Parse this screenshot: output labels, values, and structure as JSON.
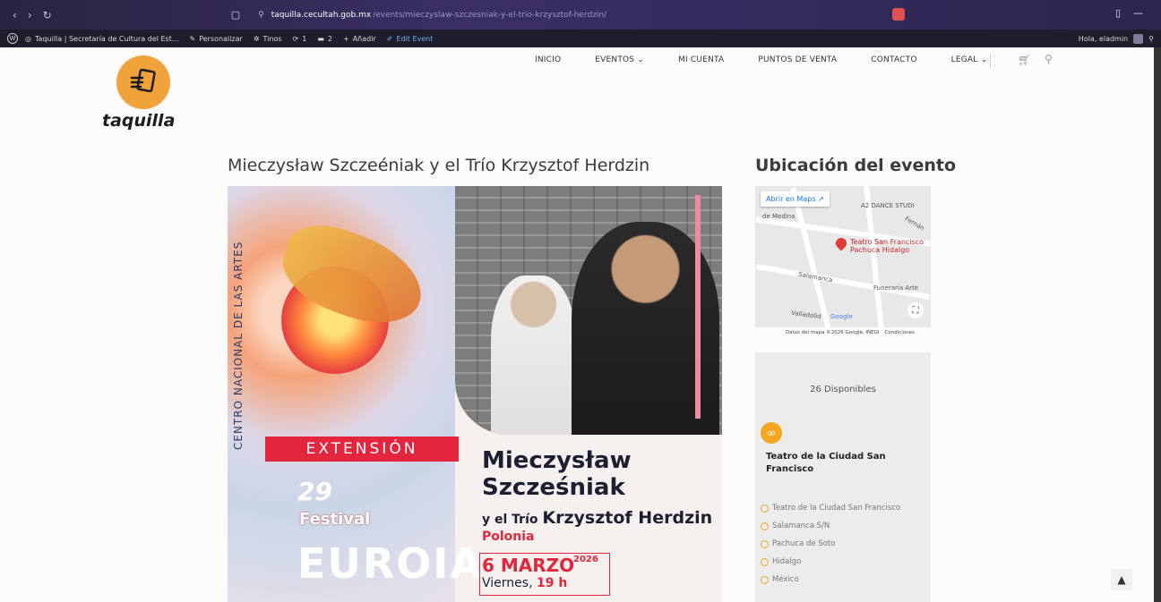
{
  "browser": {
    "url_host": "taquilla.cecultah.gob.mx",
    "url_path": "/events/mieczyslaw-szczesniak-y-el-trio-krzysztof-herdzin/"
  },
  "wp_bar": {
    "site": "Taquilla | Secretaría de Cultura del Est...",
    "customize": "Personalizar",
    "themes": "Tinos",
    "updates": "1",
    "comments": "2",
    "add": "Añadir",
    "edit": "Edit Event",
    "greeting": "Hola, eladmin"
  },
  "site": {
    "logo_text": "taquilla"
  },
  "nav": {
    "items": [
      "INICIO",
      "EVENTOS ⌄",
      "MI CUENTA",
      "PUNTOS DE VENTA",
      "CONTACTO",
      "LEGAL ⌄"
    ]
  },
  "event": {
    "title": "Mieczysław Szczeéniak y el Trío Krzysztof Herdzin"
  },
  "poster": {
    "vertical": "CENTRO NACIONAL DE LAS ARTES",
    "extension": "EXTENSIÓN",
    "fest_num": "29",
    "fest_label": "Festival",
    "fest_euro": "EUROIA",
    "artist": "Mieczysław Szcześniak",
    "sub_prefix": "y el Trío",
    "sub_name": "Krzysztof Herdzin",
    "country": "Polonia",
    "date": "6 MARZO",
    "year": "2026",
    "day": "Viernes,",
    "time": "19 h"
  },
  "map": {
    "title": "Ubicación del evento",
    "open_btn": "Abrir en Maps ↗",
    "place": "Teatro San Francisco Pachuca Hidalgo",
    "labels": {
      "dance": "A2 DANCE STUDI",
      "medina": "de Medina",
      "fernan": "Fernán",
      "salamanca": "Salamanca",
      "funeraria": "Funeraria Arte",
      "valladolid": "Valladolid",
      "google": "Google"
    },
    "footer_data": "Datos del mapa ©2026 Google, INEGI",
    "footer_terms": "Condiciones"
  },
  "tickets": {
    "available": "26 Disponibles",
    "venue": "Teatro de la Ciudad San Francisco",
    "address": [
      "Teatro de la Ciudad San Francisco",
      "Salamanca S/N",
      "Pachuca de Soto",
      "Hidalgo",
      "México"
    ]
  }
}
